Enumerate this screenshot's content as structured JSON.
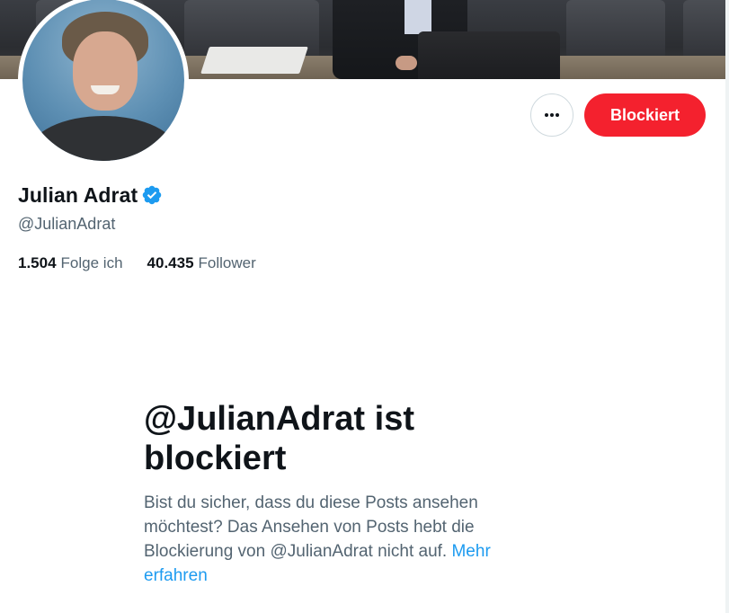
{
  "profile": {
    "display_name": "Julian Adrat",
    "verified": true,
    "handle": "@JulianAdrat",
    "stats": [
      {
        "value": "1.504",
        "label": "Folge ich"
      },
      {
        "value": "40.435",
        "label": "Follower"
      }
    ]
  },
  "actions": {
    "block_label": "Blockiert",
    "more_icon": "more-horizontal-icon"
  },
  "blocked_notice": {
    "title": "@JulianAdrat ist blockiert",
    "text": "Bist du sicher, dass du diese Posts ansehen möchtest? Das Ansehen von Posts hebt die Blockierung von @JulianAdrat nicht auf.",
    "link_label": "Mehr erfahren"
  },
  "colors": {
    "block_button": "#f4212e",
    "verified_badge": "#1d9bf0",
    "link": "#1d9bf0",
    "secondary_text": "#536471"
  }
}
